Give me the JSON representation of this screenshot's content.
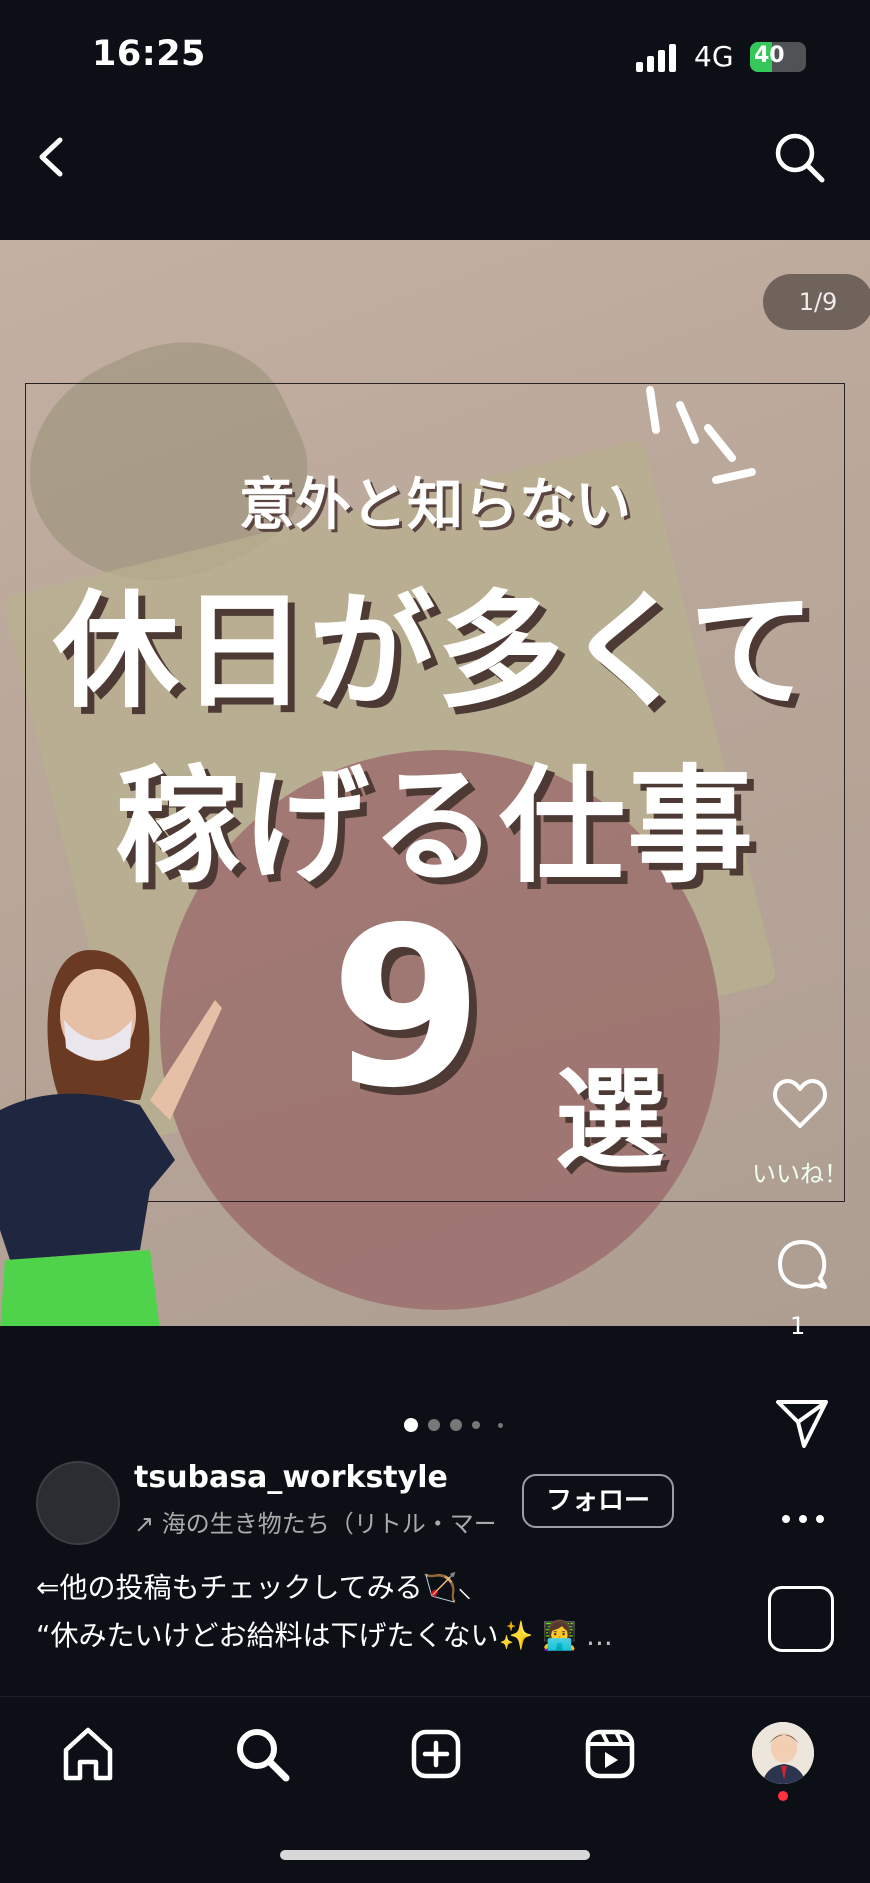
{
  "status_bar": {
    "time": "16:25",
    "network": "4G",
    "battery": "40"
  },
  "post": {
    "page_indicator": "1/9",
    "title_line1": "意外と知らない",
    "title_line2": "休日が多くて",
    "title_line3": "稼げる仕事",
    "title_number": "9",
    "title_suffix": "選",
    "like_label": "いいね！",
    "comment_count": "1",
    "carousel_position": 1,
    "carousel_total": 9
  },
  "user": {
    "username": "tsubasa_workstyle",
    "music": "↗ 海の生き物たち（リトル・マー",
    "follow_label": "フォロー"
  },
  "caption": {
    "line1": "⇐他の投稿もチェックしてみる🏹⸜",
    "line2": "“休みたいけどお給料は下げたくない✨ 👩‍💻",
    "more": "..."
  },
  "colors": {
    "background": "#0c1016",
    "accent_battery": "#35c759",
    "notification": "#ff3040"
  },
  "icons": [
    "back-icon",
    "search-icon",
    "heart-icon",
    "comment-icon",
    "share-icon",
    "more-icon",
    "save-icon",
    "home-icon",
    "create-icon",
    "reels-icon"
  ]
}
